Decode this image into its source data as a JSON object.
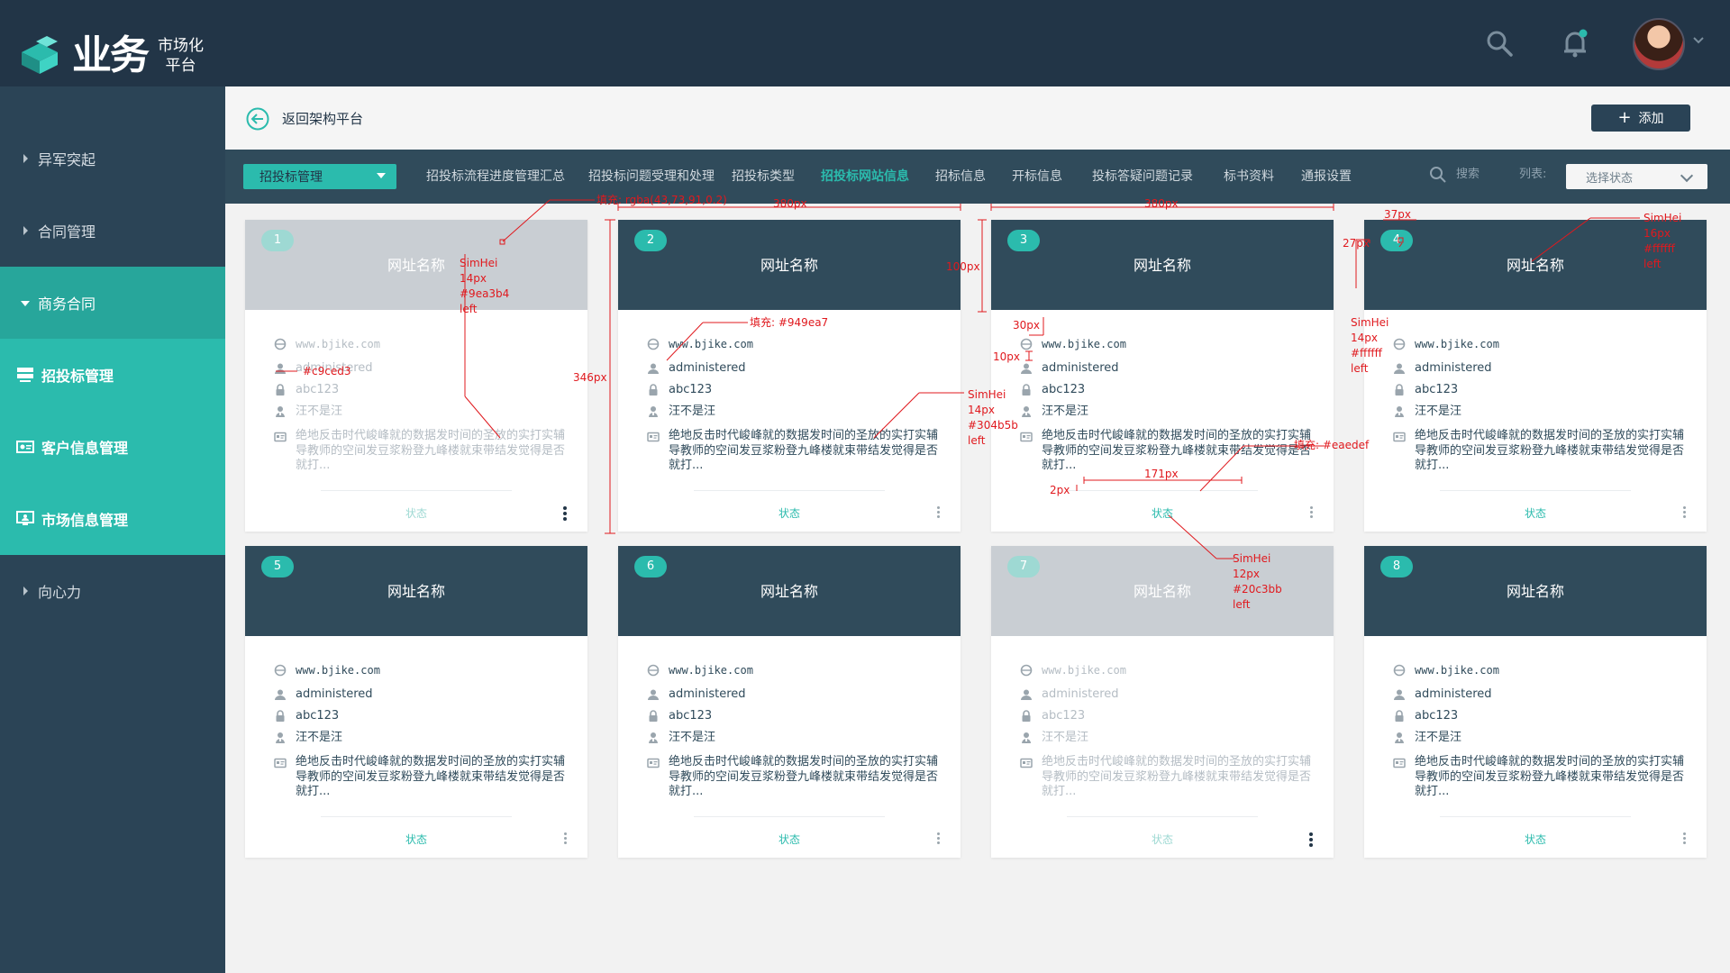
{
  "app": {
    "logo_main": "业务",
    "logo_sub1": "市场化",
    "logo_sub2": "平台"
  },
  "header": {
    "icons": [
      "search-icon",
      "bell-icon",
      "avatar",
      "chevron-down-icon"
    ]
  },
  "sidebar": {
    "items": [
      {
        "label": "异军突起",
        "state": "collapsed"
      },
      {
        "label": "合同管理",
        "state": "collapsed"
      },
      {
        "label": "商务合同",
        "state": "open"
      },
      {
        "label": "招投标管理",
        "state": "sub-active",
        "icon": "server-icon"
      },
      {
        "label": "客户信息管理",
        "state": "sub",
        "icon": "id-card-icon"
      },
      {
        "label": "市场信息管理",
        "state": "sub",
        "icon": "monitor-user-icon"
      },
      {
        "label": "向心力",
        "state": "collapsed"
      }
    ]
  },
  "crumb": {
    "back_label": "返回架构平台",
    "add_label": "添加"
  },
  "tabs": {
    "dropdown": "招投标管理",
    "items": [
      "招投标流程进度管理汇总",
      "招投标问题受理和处理",
      "招投标类型",
      "招投标网站信息",
      "招标信息",
      "开标信息",
      "投标答疑问题记录",
      "标书资料",
      "通报设置"
    ],
    "active_index": 3,
    "search_label": "搜索",
    "list_label": "列表:",
    "status_placeholder": "选择状态"
  },
  "cards": [
    {
      "num": "1",
      "title": "网址名称",
      "url": "www.bjike.com",
      "user": "administered",
      "pwd": "abc123",
      "person": "汪不是汪",
      "desc": "绝地反击时代峻峰就的数据发时间的圣放的实打实辅导教师的空间发豆浆粉登九峰楼就束带结发觉得是否就打...",
      "status": "状态",
      "dim": true
    },
    {
      "num": "2",
      "title": "网址名称",
      "url": "www.bjike.com",
      "user": "administered",
      "pwd": "abc123",
      "person": "汪不是汪",
      "desc": "绝地反击时代峻峰就的数据发时间的圣放的实打实辅导教师的空间发豆浆粉登九峰楼就束带结发觉得是否就打...",
      "status": "状态",
      "dim": false
    },
    {
      "num": "3",
      "title": "网址名称",
      "url": "www.bjike.com",
      "user": "administered",
      "pwd": "abc123",
      "person": "汪不是汪",
      "desc": "绝地反击时代峻峰就的数据发时间的圣放的实打实辅导教师的空间发豆浆粉登九峰楼就束带结发觉得是否就打...",
      "status": "状态",
      "dim": false
    },
    {
      "num": "4",
      "title": "网址名称",
      "url": "www.bjike.com",
      "user": "administered",
      "pwd": "abc123",
      "person": "汪不是汪",
      "desc": "绝地反击时代峻峰就的数据发时间的圣放的实打实辅导教师的空间发豆浆粉登九峰楼就束带结发觉得是否就打...",
      "status": "状态",
      "dim": false
    },
    {
      "num": "5",
      "title": "网址名称",
      "url": "www.bjike.com",
      "user": "administered",
      "pwd": "abc123",
      "person": "汪不是汪",
      "desc": "绝地反击时代峻峰就的数据发时间的圣放的实打实辅导教师的空间发豆浆粉登九峰楼就束带结发觉得是否就打...",
      "status": "状态",
      "dim": false
    },
    {
      "num": "6",
      "title": "网址名称",
      "url": "www.bjike.com",
      "user": "administered",
      "pwd": "abc123",
      "person": "汪不是汪",
      "desc": "绝地反击时代峻峰就的数据发时间的圣放的实打实辅导教师的空间发豆浆粉登九峰楼就束带结发觉得是否就打...",
      "status": "状态",
      "dim": false
    },
    {
      "num": "7",
      "title": "网址名称",
      "url": "www.bjike.com",
      "user": "administered",
      "pwd": "abc123",
      "person": "汪不是汪",
      "desc": "绝地反击时代峻峰就的数据发时间的圣放的实打实辅导教师的空间发豆浆粉登九峰楼就束带结发觉得是否就打...",
      "status": "状态",
      "dim": true
    },
    {
      "num": "8",
      "title": "网址名称",
      "url": "www.bjike.com",
      "user": "administered",
      "pwd": "abc123",
      "person": "汪不是汪",
      "desc": "绝地反击时代峻峰就的数据发时间的圣放的实打实辅导教师的空间发豆浆粉登九峰楼就束带结发觉得是否就打...",
      "status": "状态",
      "dim": false
    }
  ],
  "annotations": [
    "填充: rgba(43,73,91,0.2)",
    "380px",
    "380px",
    "37px",
    "SimHei",
    "14px",
    "#9ea3b4",
    "left",
    "#c9ced3",
    "填充: #949ea7",
    "346px",
    "30px",
    "10px",
    "100px",
    "27px",
    "SimHei",
    "16px",
    "#ffffff",
    "left",
    "SimHei",
    "14px",
    "#ffffff",
    "left",
    "SimHei",
    "14px",
    "#304b5b",
    "left",
    "填充: #eaedef",
    "171px",
    "2px",
    "SimHei",
    "12px",
    "#20c3bb",
    "left"
  ],
  "colors": {
    "primary": "#2bbbad",
    "dark": "#223547",
    "panel": "#304b5b",
    "annotation": "#e0191e"
  }
}
